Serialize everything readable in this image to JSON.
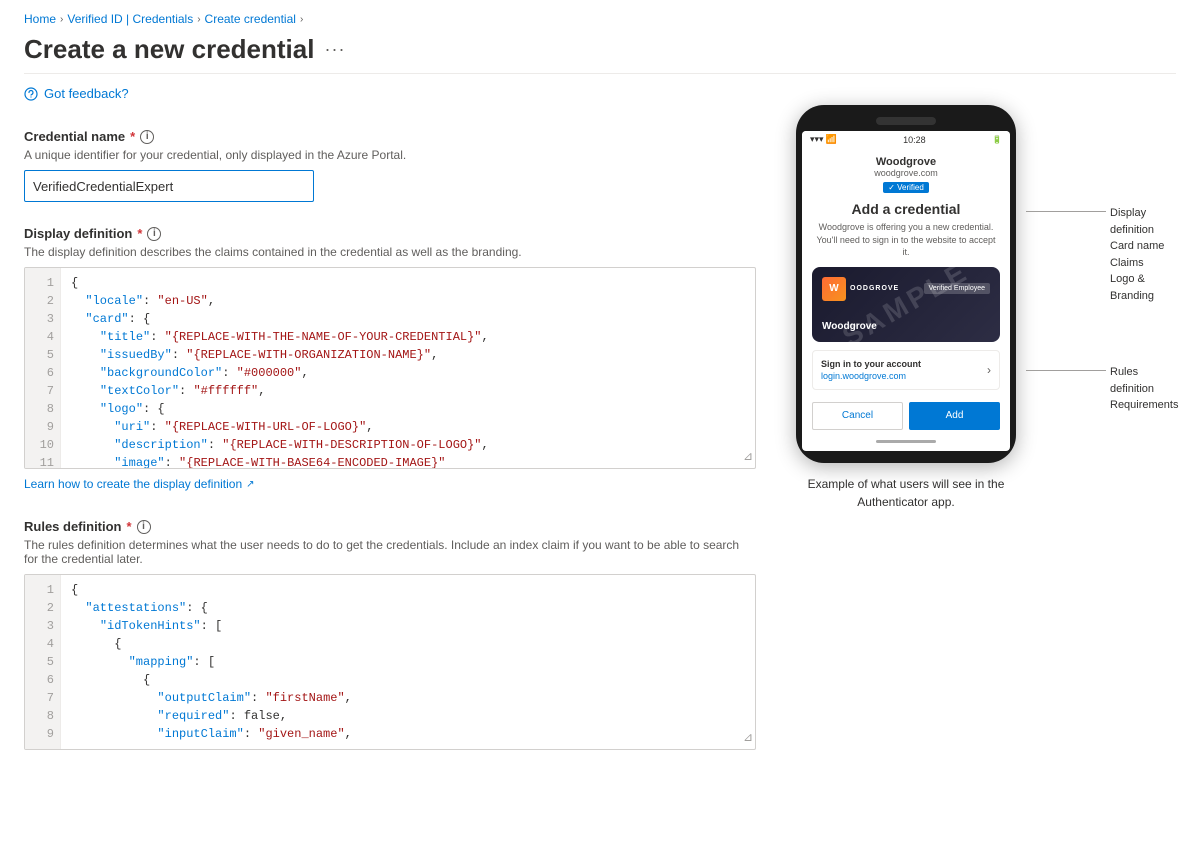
{
  "breadcrumb": {
    "home": "Home",
    "verified_id": "Verified ID | Credentials",
    "create_credential": "Create credential",
    "sep": "›"
  },
  "page": {
    "title": "Create a new credential",
    "more_label": "···"
  },
  "feedback": {
    "label": "Got feedback?"
  },
  "credential_name": {
    "label": "Credential name",
    "required": "*",
    "desc": "A unique identifier for your credential, only displayed in the Azure Portal.",
    "value": "VerifiedCredentialExpert",
    "placeholder": ""
  },
  "display_definition": {
    "label": "Display definition",
    "required": "*",
    "desc": "The display definition describes the claims contained in the credential as well as the branding.",
    "lines": [
      {
        "num": "1",
        "code": "{"
      },
      {
        "num": "2",
        "code": "  \"locale\": \"en-US\","
      },
      {
        "num": "3",
        "code": "  \"card\": {"
      },
      {
        "num": "4",
        "code": "    \"title\": \"{REPLACE-WITH-THE-NAME-OF-YOUR-CREDENTIAL}\","
      },
      {
        "num": "5",
        "code": "    \"issuedBy\": \"{REPLACE-WITH-ORGANIZATION-NAME}\","
      },
      {
        "num": "6",
        "code": "    \"backgroundColor\": \"#000000\","
      },
      {
        "num": "7",
        "code": "    \"textColor\": \"#ffffff\","
      },
      {
        "num": "8",
        "code": "    \"logo\": {"
      },
      {
        "num": "9",
        "code": "      \"uri\": \"{REPLACE-WITH-URL-OF-LOGO}\","
      },
      {
        "num": "10",
        "code": "      \"description\": \"{REPLACE-WITH-DESCRIPTION-OF-LOGO}\","
      },
      {
        "num": "11",
        "code": "      \"image\": \"{REPLACE-WITH-BASE64-ENCODED-IMAGE}\""
      }
    ],
    "learn_link": "Learn how to create the display definition",
    "ext_icon": "↗"
  },
  "rules_definition": {
    "label": "Rules definition",
    "required": "*",
    "desc": "The rules definition determines what the user needs to do to get the credentials. Include an index claim if you want to be able to search for the credential later.",
    "lines": [
      {
        "num": "1",
        "code": "{"
      },
      {
        "num": "2",
        "code": "  \"attestations\": {"
      },
      {
        "num": "3",
        "code": "    \"idTokenHints\": ["
      },
      {
        "num": "4",
        "code": "      {"
      },
      {
        "num": "5",
        "code": "        \"mapping\": ["
      },
      {
        "num": "6",
        "code": "          {"
      },
      {
        "num": "7",
        "code": "            \"outputClaim\": \"firstName\","
      },
      {
        "num": "8",
        "code": "            \"required\": false,"
      },
      {
        "num": "9",
        "code": "            \"inputClaim\": \"given_name\","
      }
    ]
  },
  "phone": {
    "time": "10:28",
    "org_name": "Woodgrove",
    "org_domain": "woodgrove.com",
    "verified_label": "✓ Verified",
    "add_credential_title": "Add a credential",
    "add_credential_subtitle": "Woodgrove is offering you a new credential. You'll need to sign in to the website to accept it.",
    "logo_letter": "W",
    "logo_text": "OODGROVE",
    "card_type": "Verified Employee",
    "card_org": "Woodgrove",
    "sample_text": "SAMPLE",
    "signin_text": "Sign in to your account",
    "signin_link": "login.woodgrove.com",
    "cancel_btn": "Cancel",
    "add_btn": "Add",
    "caption": "Example of what users will see in the Authenticator app."
  },
  "annotations": {
    "display": {
      "label": "Display\ndefinition",
      "items": "Card name\nClaims\nLogo &\nBranding"
    },
    "rules": {
      "label": "Rules\ndefinition",
      "items": "Requirements"
    }
  }
}
